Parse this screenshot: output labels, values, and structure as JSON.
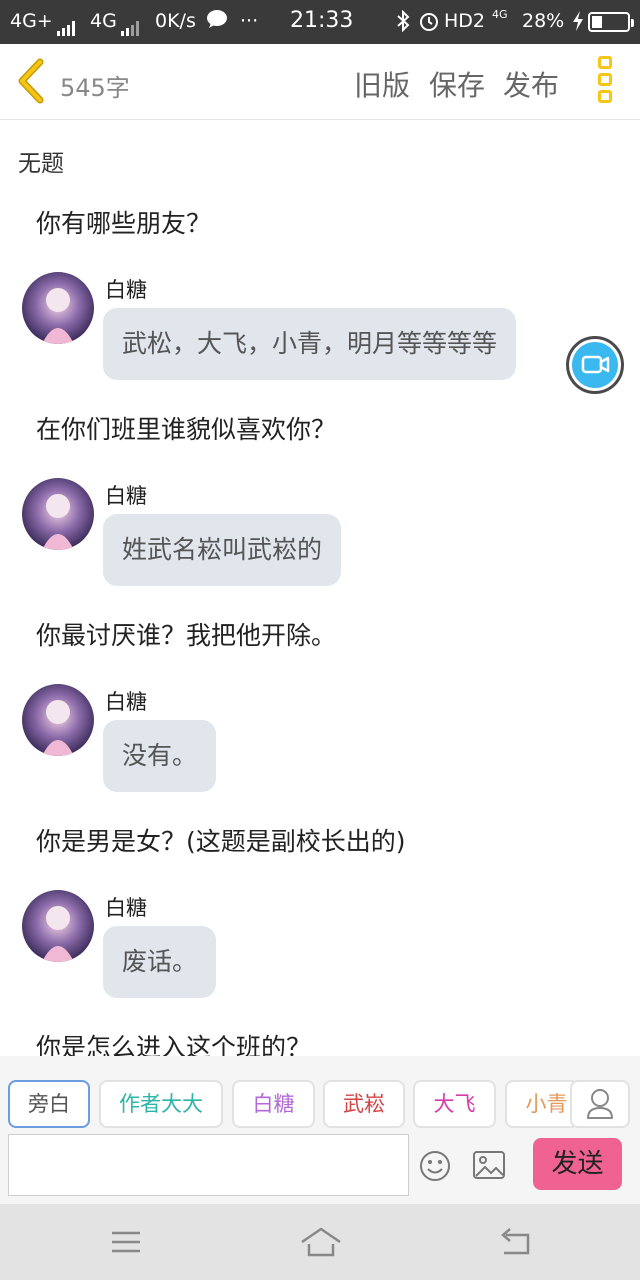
{
  "status_bar": {
    "network1": "4G+",
    "network2": "4G",
    "speed": "0K/s",
    "more": "···",
    "time": "21:33",
    "hd": "HD2",
    "tag_4g": "4G",
    "battery": "28%",
    "battery_level": 0.28
  },
  "header": {
    "word_count": "545字",
    "old_version": "旧版",
    "save": "保存",
    "publish": "发布"
  },
  "title": "无题",
  "content": {
    "items": [
      {
        "type": "question",
        "text": "你有哪些朋友？"
      },
      {
        "type": "reply",
        "speaker": "白糖",
        "text": "武松，大飞，小青，明月等等等等"
      },
      {
        "type": "question",
        "text": "在你们班里谁貌似喜欢你？"
      },
      {
        "type": "reply",
        "speaker": "白糖",
        "text": "姓武名崧叫武崧的"
      },
      {
        "type": "question",
        "text": "你最讨厌谁？我把他开除。"
      },
      {
        "type": "reply",
        "speaker": "白糖",
        "text": "没有。"
      },
      {
        "type": "question",
        "text": "你是男是女？(这题是副校长出的)"
      },
      {
        "type": "reply",
        "speaker": "白糖",
        "text": "废话。"
      },
      {
        "type": "question",
        "text": "你是怎么进入这个班的？"
      }
    ]
  },
  "characters": [
    {
      "label": "旁白",
      "color": "#555555"
    },
    {
      "label": "作者大大",
      "color": "#2bb5a8"
    },
    {
      "label": "白糖",
      "color": "#b36ad6"
    },
    {
      "label": "武崧",
      "color": "#d24545"
    },
    {
      "label": "大飞",
      "color": "#d83aa8"
    },
    {
      "label": "小青",
      "color": "#e39a5c"
    }
  ],
  "input": {
    "value": "",
    "placeholder": "",
    "send_label": "发送"
  },
  "colors": {
    "accent_yellow": "#f5c518",
    "send_pink": "#f06292",
    "bubble_bg": "#e1e5ec",
    "camera_blue": "#3ab8f0"
  },
  "icons": {
    "back": "chevron-left-icon",
    "menu": "vertical-dots-icon",
    "camera": "video-camera-icon",
    "user": "user-icon",
    "emoji": "emoji-icon",
    "image": "image-icon",
    "nav_menu": "hamburger-icon",
    "nav_home": "home-icon",
    "nav_back": "back-arrow-icon"
  }
}
